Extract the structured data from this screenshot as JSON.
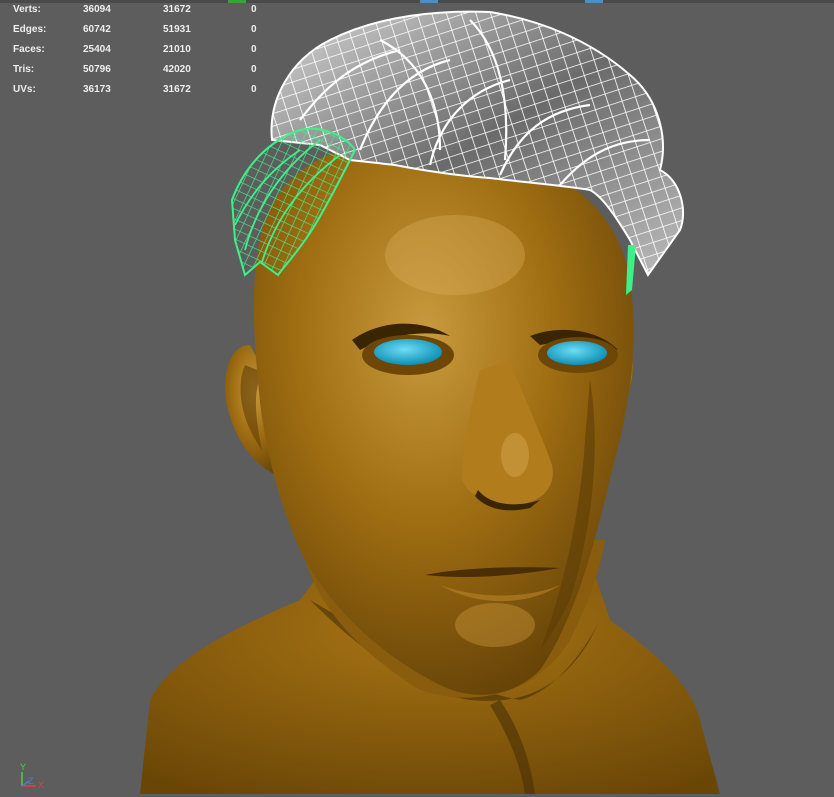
{
  "hud": {
    "rows": [
      {
        "label": "Verts:",
        "values": [
          "36094",
          "31672",
          "0"
        ]
      },
      {
        "label": "Edges:",
        "values": [
          "60742",
          "51931",
          "0"
        ]
      },
      {
        "label": "Faces:",
        "values": [
          "25404",
          "21010",
          "0"
        ]
      },
      {
        "label": "Tris:",
        "values": [
          "50796",
          "42020",
          "0"
        ]
      },
      {
        "label": "UVs:",
        "values": [
          "36173",
          "31672",
          "0"
        ]
      }
    ]
  },
  "axis": {
    "y_label": "Y",
    "x_label": "X",
    "z_label": "Z"
  },
  "colors": {
    "viewport_bg": "#5d5d5d",
    "skin": "#9a6a10",
    "eye": "#1aa9d0",
    "wire_selected": "#3df08a",
    "wire_default": "#ffffff"
  }
}
